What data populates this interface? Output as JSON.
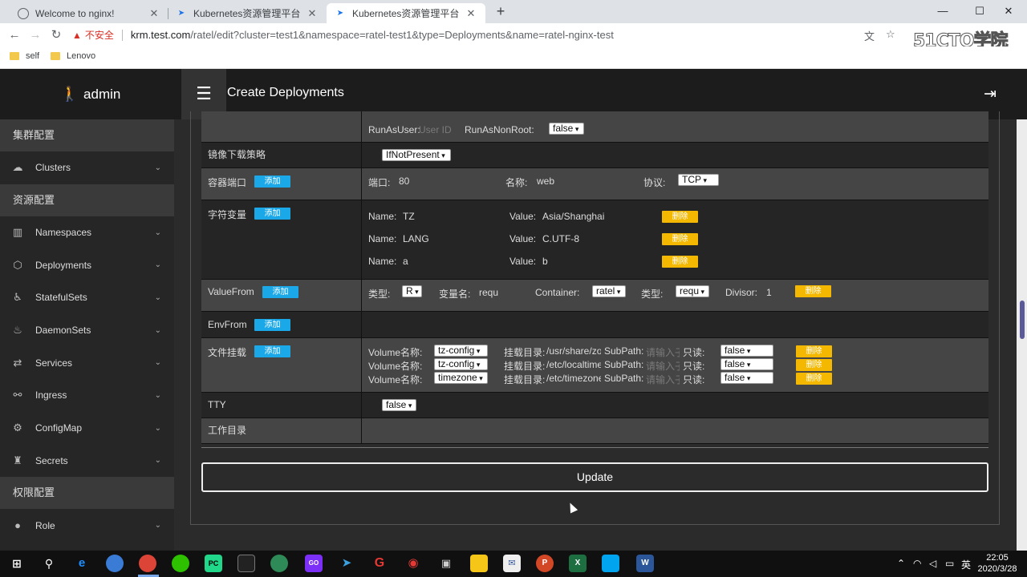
{
  "browser": {
    "tabs": [
      {
        "title": "Welcome to nginx!",
        "active": false
      },
      {
        "title": "Kubernetes资源管理平台",
        "active": false
      },
      {
        "title": "Kubernetes资源管理平台",
        "active": true
      }
    ],
    "new_tab": "+",
    "close_glyph": "✕",
    "window_controls": {
      "minimize": "—",
      "maximize": "☐",
      "close": "✕"
    },
    "security_label": "不安全",
    "url_host": "krm.test.com",
    "url_path": "/ratel/edit?cluster=test1&namespace=ratel-test1&type=Deployments&name=ratel-nginx-test",
    "bookmarks": [
      "self",
      "Lenovo"
    ],
    "watermark": "51CTO学院"
  },
  "header": {
    "brand": "admin",
    "title": "Create Deployments"
  },
  "sidebar": {
    "sections": [
      {
        "label": "集群配置",
        "items": [
          {
            "label": "Clusters",
            "icon": "cloud-icon"
          }
        ]
      },
      {
        "label": "资源配置",
        "items": [
          {
            "label": "Namespaces",
            "icon": "namespace-icon"
          },
          {
            "label": "Deployments",
            "icon": "cube-icon"
          },
          {
            "label": "StatefulSets",
            "icon": "statefulset-icon"
          },
          {
            "label": "DaemonSets",
            "icon": "fire-icon"
          },
          {
            "label": "Services",
            "icon": "exchange-icon"
          },
          {
            "label": "Ingress",
            "icon": "link-icon"
          },
          {
            "label": "ConfigMap",
            "icon": "cogs-icon"
          },
          {
            "label": "Secrets",
            "icon": "secret-icon"
          }
        ]
      },
      {
        "label": "权限配置",
        "items": [
          {
            "label": "Role",
            "icon": "user-icon"
          }
        ]
      }
    ]
  },
  "form": {
    "security": {
      "run_as_user_label": "RunAsUser:",
      "run_as_user_placeholder": "User ID",
      "run_as_non_root_label": "RunAsNonRoot:",
      "run_as_non_root_value": "false"
    },
    "image_pull": {
      "label": "镜像下载策略",
      "value": "IfNotPresent"
    },
    "ports": {
      "label": "容器端口",
      "add": "添加",
      "port_label": "端口:",
      "port_value": "80",
      "name_label": "名称:",
      "name_value": "web",
      "protocol_label": "协议:",
      "protocol_value": "TCP"
    },
    "env": {
      "label": "字符变量",
      "add": "添加",
      "name_label": "Name:",
      "value_label": "Value:",
      "delete": "删除",
      "items": [
        {
          "name": "TZ",
          "value": "Asia/Shanghai"
        },
        {
          "name": "LANG",
          "value": "C.UTF-8"
        },
        {
          "name": "a",
          "value": "b"
        }
      ]
    },
    "value_from": {
      "label": "ValueFrom",
      "add": "添加",
      "type_label": "类型:",
      "type_value": "R",
      "var_label": "变量名:",
      "var_value": "requ",
      "container_label": "Container:",
      "container_value": "ratel",
      "type2_label": "类型:",
      "type2_value": "requ",
      "divisor_label": "Divisor:",
      "divisor_value": "1",
      "delete": "删除"
    },
    "env_from": {
      "label": "EnvFrom",
      "add": "添加"
    },
    "volumes": {
      "label": "文件挂载",
      "add": "添加",
      "vol_label": "Volume名称:",
      "mount_label": "挂载目录:",
      "subpath_label": "SubPath:",
      "subpath_placeholder": "请输入子",
      "readonly_label": "只读:",
      "delete": "删除",
      "items": [
        {
          "name": "tz-config",
          "mount": "/usr/share/zo",
          "readonly": "false"
        },
        {
          "name": "tz-config",
          "mount": "/etc/localtime",
          "readonly": "false"
        },
        {
          "name": "timezone",
          "mount": "/etc/timezone",
          "readonly": "false"
        }
      ]
    },
    "tty": {
      "label": "TTY",
      "value": "false"
    },
    "workdir": {
      "label": "工作目录"
    },
    "update": "Update"
  },
  "taskbar": {
    "ime": "英",
    "time": "22:05",
    "date": "2020/3/28"
  }
}
